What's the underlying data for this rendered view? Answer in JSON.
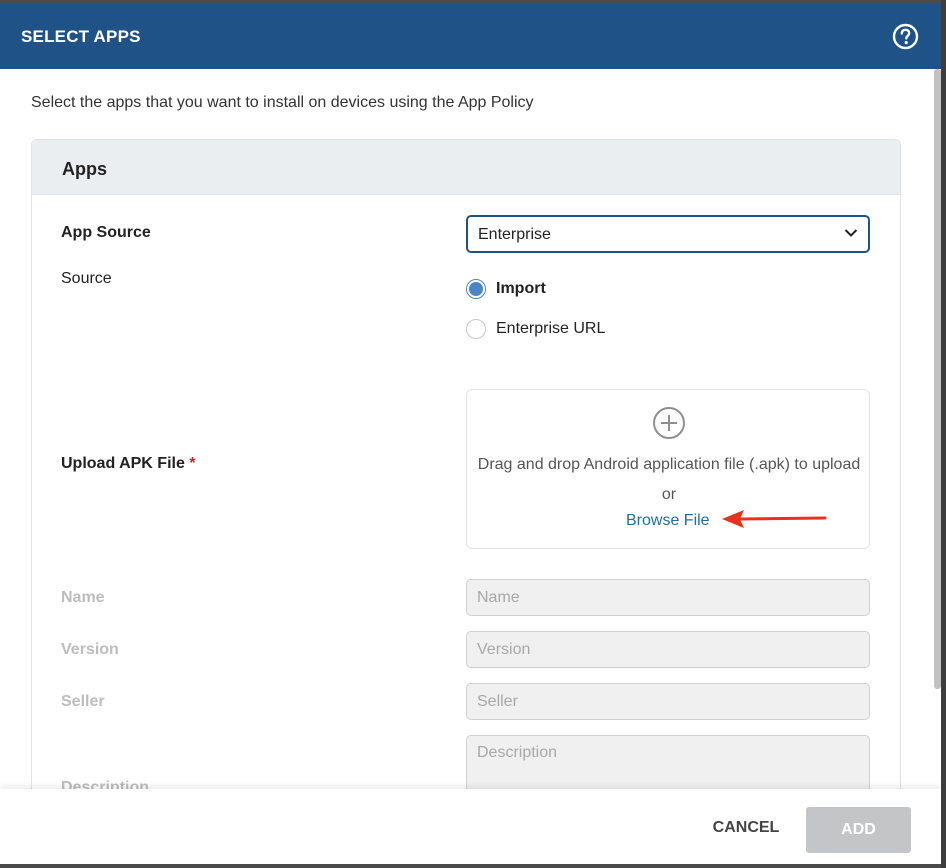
{
  "dialog": {
    "title": "SELECT APPS",
    "intro": "Select the apps that you want to install on devices using the App Policy"
  },
  "panel": {
    "title": "Apps",
    "app_source_label": "App Source",
    "app_source_value": "Enterprise",
    "source_label": "Source",
    "source_options": [
      {
        "label": "Import",
        "selected": true
      },
      {
        "label": "Enterprise URL",
        "selected": false
      }
    ],
    "upload_label": "Upload APK File",
    "required_mark": "*",
    "drop_text": "Drag and drop Android application file (.apk) to upload",
    "drop_or": "or",
    "browse_label": "Browse File",
    "fields": {
      "name_label": "Name",
      "name_placeholder": "Name",
      "version_label": "Version",
      "version_placeholder": "Version",
      "seller_label": "Seller",
      "seller_placeholder": "Seller",
      "description_label": "Description",
      "description_placeholder": "Description"
    }
  },
  "footer": {
    "cancel_label": "CANCEL",
    "add_label": "ADD"
  },
  "icons": {
    "help": "help-circle-icon",
    "dropdown": "chevron-down-icon",
    "upload": "plus-circle-icon",
    "annotation": "red-arrow-icon"
  },
  "colors": {
    "header": "#1f5287",
    "accent": "#4a86c5",
    "link": "#1a6fa3",
    "annotation_arrow": "#e8321e",
    "disabled_button": "#c3c5c7"
  }
}
